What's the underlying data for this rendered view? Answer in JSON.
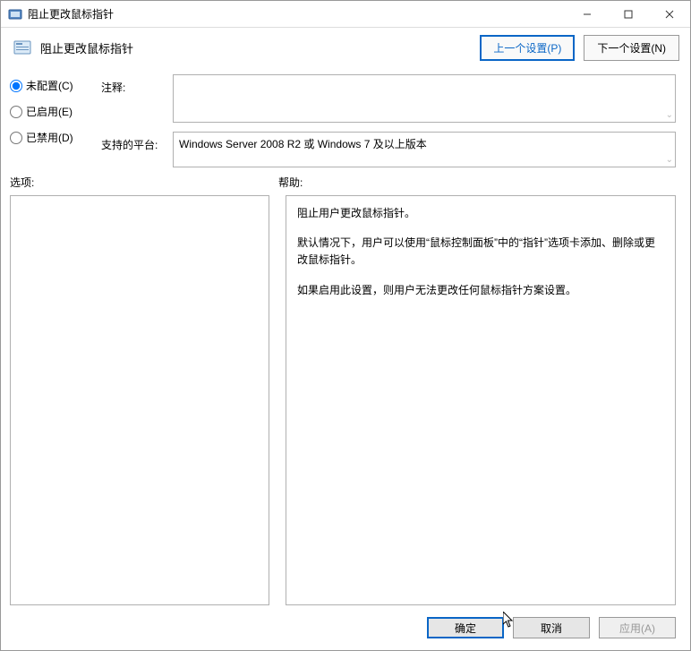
{
  "window": {
    "title": "阻止更改鼠标指针"
  },
  "header": {
    "setting_title": "阻止更改鼠标指针",
    "prev_btn": "上一个设置(P)",
    "next_btn": "下一个设置(N)"
  },
  "radios": {
    "not_configured": "未配置(C)",
    "enabled": "已启用(E)",
    "disabled": "已禁用(D)"
  },
  "fields": {
    "comment_label": "注释:",
    "comment_value": "",
    "platform_label": "支持的平台:",
    "platform_value": "Windows Server 2008 R2 或 Windows 7 及以上版本"
  },
  "lower": {
    "options_label": "选项:",
    "help_label": "帮助:"
  },
  "help": {
    "p1": "阻止用户更改鼠标指针。",
    "p2": "默认情况下，用户可以使用“鼠标控制面板”中的“指针”选项卡添加、删除或更改鼠标指针。",
    "p3": "如果启用此设置，则用户无法更改任何鼠标指针方案设置。"
  },
  "footer": {
    "ok": "确定",
    "cancel": "取消",
    "apply": "应用(A)"
  }
}
